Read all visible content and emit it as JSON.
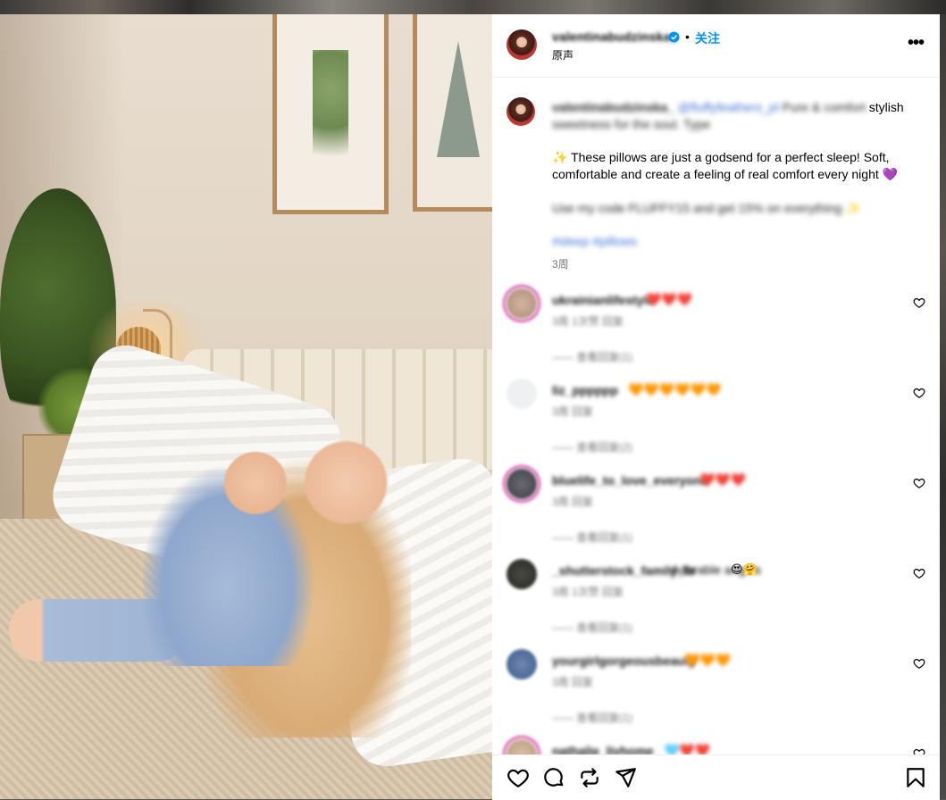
{
  "post": {
    "username": "valentinabudzinska_",
    "dot": "•",
    "follow_label": "关注",
    "audio_label": "原声",
    "more_label": "•••"
  },
  "caption": {
    "username": "valentinabudzinska_",
    "mention": "@fluffyfeathers_pl",
    "blurred_inline": "Pure & comfort",
    "tail_word": "stylish",
    "line2_blurred": "sweetness for the soul. Type",
    "body": "✨ These pillows are just a godsend for a perfect sleep! Soft, comfortable and create a feeling of real comfort every night 💜",
    "line3_blurred": "Use my code FLUFFY15 and get 15% on everything ✨",
    "tags_blurred": "#sleep #pillows",
    "timestamp": "3周"
  },
  "comments": [
    {
      "user": "ukrainianlifestyle",
      "text": "❤️❤️❤️",
      "meta": "3周  1次赞  回复",
      "replies": "—— 查看回复(1)"
    },
    {
      "user": "liz_pppppp",
      "text": "🧡🧡🧡🧡🧡🧡",
      "meta": "3周  回复",
      "replies": "—— 查看回复(2)"
    },
    {
      "user": "bluelife_to_love_everyone",
      "text": "❤️❤️❤️",
      "meta": "3周  回复",
      "replies": "—— 查看回复(1)"
    },
    {
      "user": "_shutterstock_family_fe",
      "text": "Adorable angels",
      "text_emoji": "😍🤗",
      "meta": "3周  1次赞  回复",
      "replies": "—— 查看回复(1)"
    },
    {
      "user": "yourgirlgorgeousbeauty",
      "text": "🧡🧡🧡",
      "meta": "3周  回复",
      "replies": "—— 查看回复(1)"
    },
    {
      "user": "nathalie_livhome",
      "text": "🩵❤️❤️",
      "meta": "",
      "replies": ""
    }
  ],
  "actions": {
    "like": "heart-icon",
    "comment": "comment-icon",
    "share": "repost-icon",
    "send": "send-icon",
    "save": "bookmark-icon"
  },
  "colors": {
    "accent": "#0095f6",
    "verified": "#0095f6",
    "muted": "#737373",
    "story_ring": "#d6249f"
  }
}
